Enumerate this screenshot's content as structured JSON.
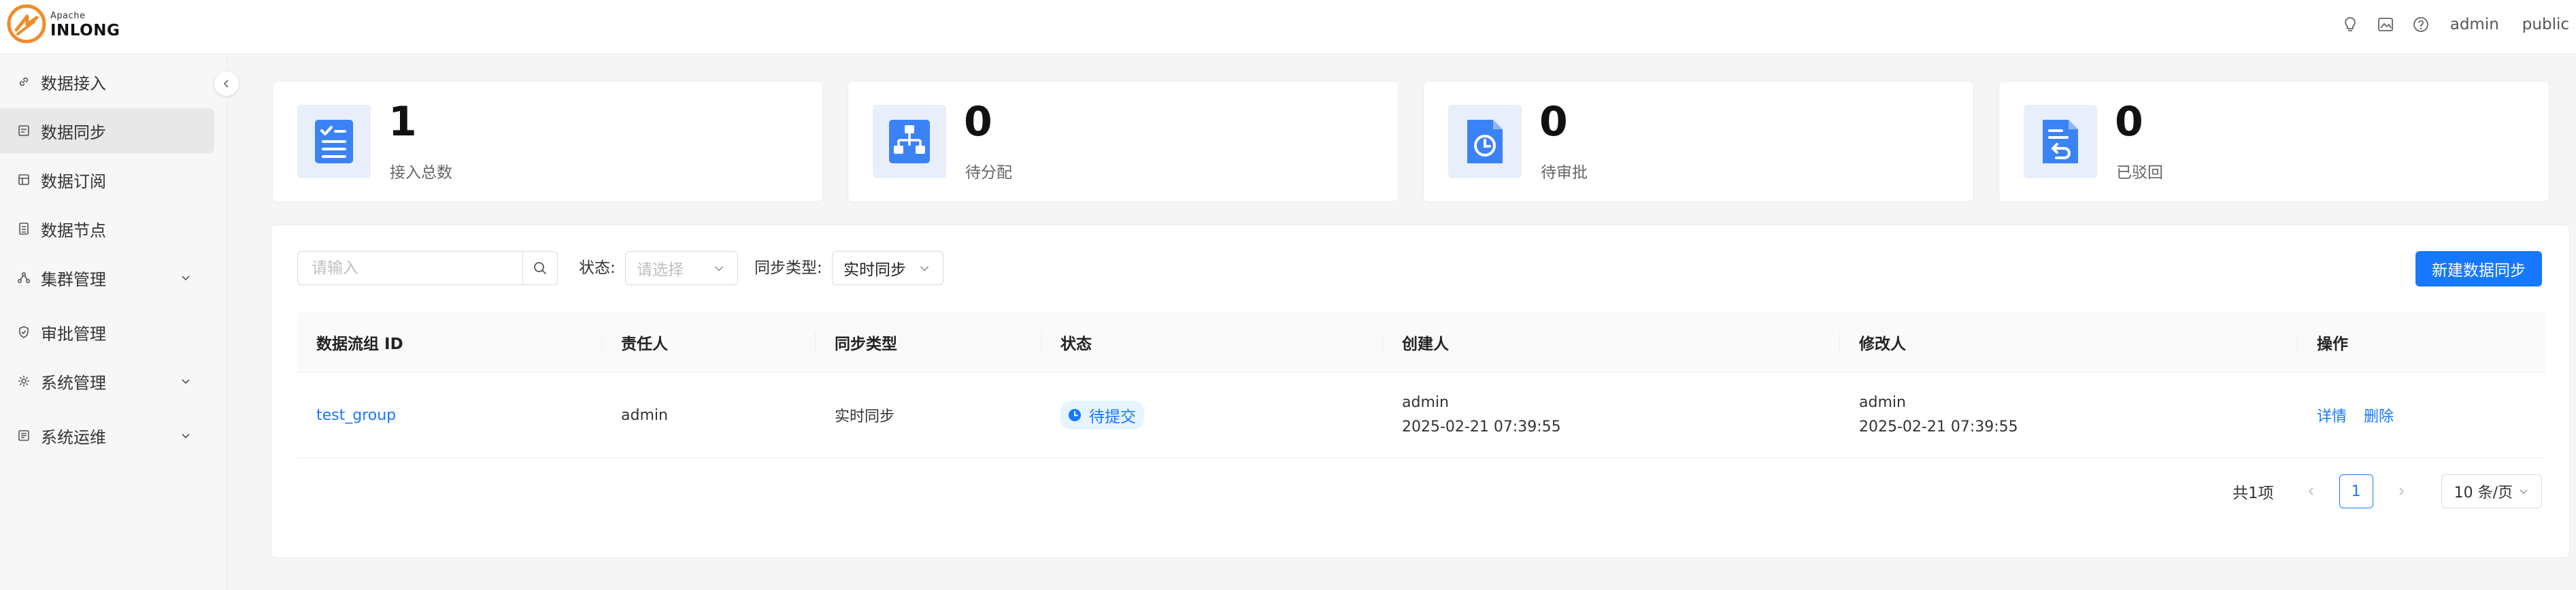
{
  "app": {
    "brand_small": "Apache",
    "brand_big": "INLONG",
    "brand_colors": {
      "orange": "#f08c28",
      "dark": "#111111"
    }
  },
  "header": {
    "icons": [
      "bulb-icon",
      "image-icon",
      "help-icon"
    ],
    "user": "admin",
    "tenant": "public"
  },
  "sidebar": {
    "items": [
      {
        "label": "数据接入",
        "icon": "link-icon",
        "expandable": false,
        "active": false
      },
      {
        "label": "数据同步",
        "icon": "sync-icon",
        "expandable": false,
        "active": true
      },
      {
        "label": "数据订阅",
        "icon": "subscribe-icon",
        "expandable": false,
        "active": false
      },
      {
        "label": "数据节点",
        "icon": "node-icon",
        "expandable": false,
        "active": false
      },
      {
        "label": "集群管理",
        "icon": "cluster-icon",
        "expandable": true,
        "active": false
      },
      {
        "label": "审批管理",
        "icon": "shield-icon",
        "expandable": false,
        "active": false
      },
      {
        "label": "系统管理",
        "icon": "gear-icon",
        "expandable": true,
        "active": false
      },
      {
        "label": "系统运维",
        "icon": "ops-icon",
        "expandable": true,
        "active": false
      }
    ]
  },
  "stats": [
    {
      "value": "1",
      "label": "接入总数",
      "icon": "checklist-icon"
    },
    {
      "value": "0",
      "label": "待分配",
      "icon": "hierarchy-icon"
    },
    {
      "value": "0",
      "label": "待审批",
      "icon": "clock-document-icon"
    },
    {
      "value": "0",
      "label": "已驳回",
      "icon": "return-document-icon"
    }
  ],
  "toolbar": {
    "search_placeholder": "请输入",
    "status_label": "状态:",
    "status_placeholder": "请选择",
    "sync_type_label": "同步类型:",
    "sync_type_value": "实时同步",
    "create_button": "新建数据同步"
  },
  "table": {
    "headers": [
      "数据流组 ID",
      "责任人",
      "同步类型",
      "状态",
      "创建人",
      "修改人",
      "操作"
    ],
    "rows": [
      {
        "group_id": "test_group",
        "owner": "admin",
        "sync_type": "实时同步",
        "status": "待提交",
        "creator": "admin",
        "created_at": "2025-02-21 07:39:55",
        "modifier": "admin",
        "modified_at": "2025-02-21 07:39:55",
        "actions": [
          "详情",
          "删除"
        ]
      }
    ]
  },
  "pagination": {
    "total_text": "共1项",
    "current_page": "1",
    "page_size": "10 条/页"
  },
  "colors": {
    "primary": "#1677ff",
    "stat_icon_bg": "#e8effa",
    "stat_icon_fg": "#3b82f6",
    "sidebar_bg": "#f7f7f7",
    "main_bg": "#f5f5f5"
  }
}
